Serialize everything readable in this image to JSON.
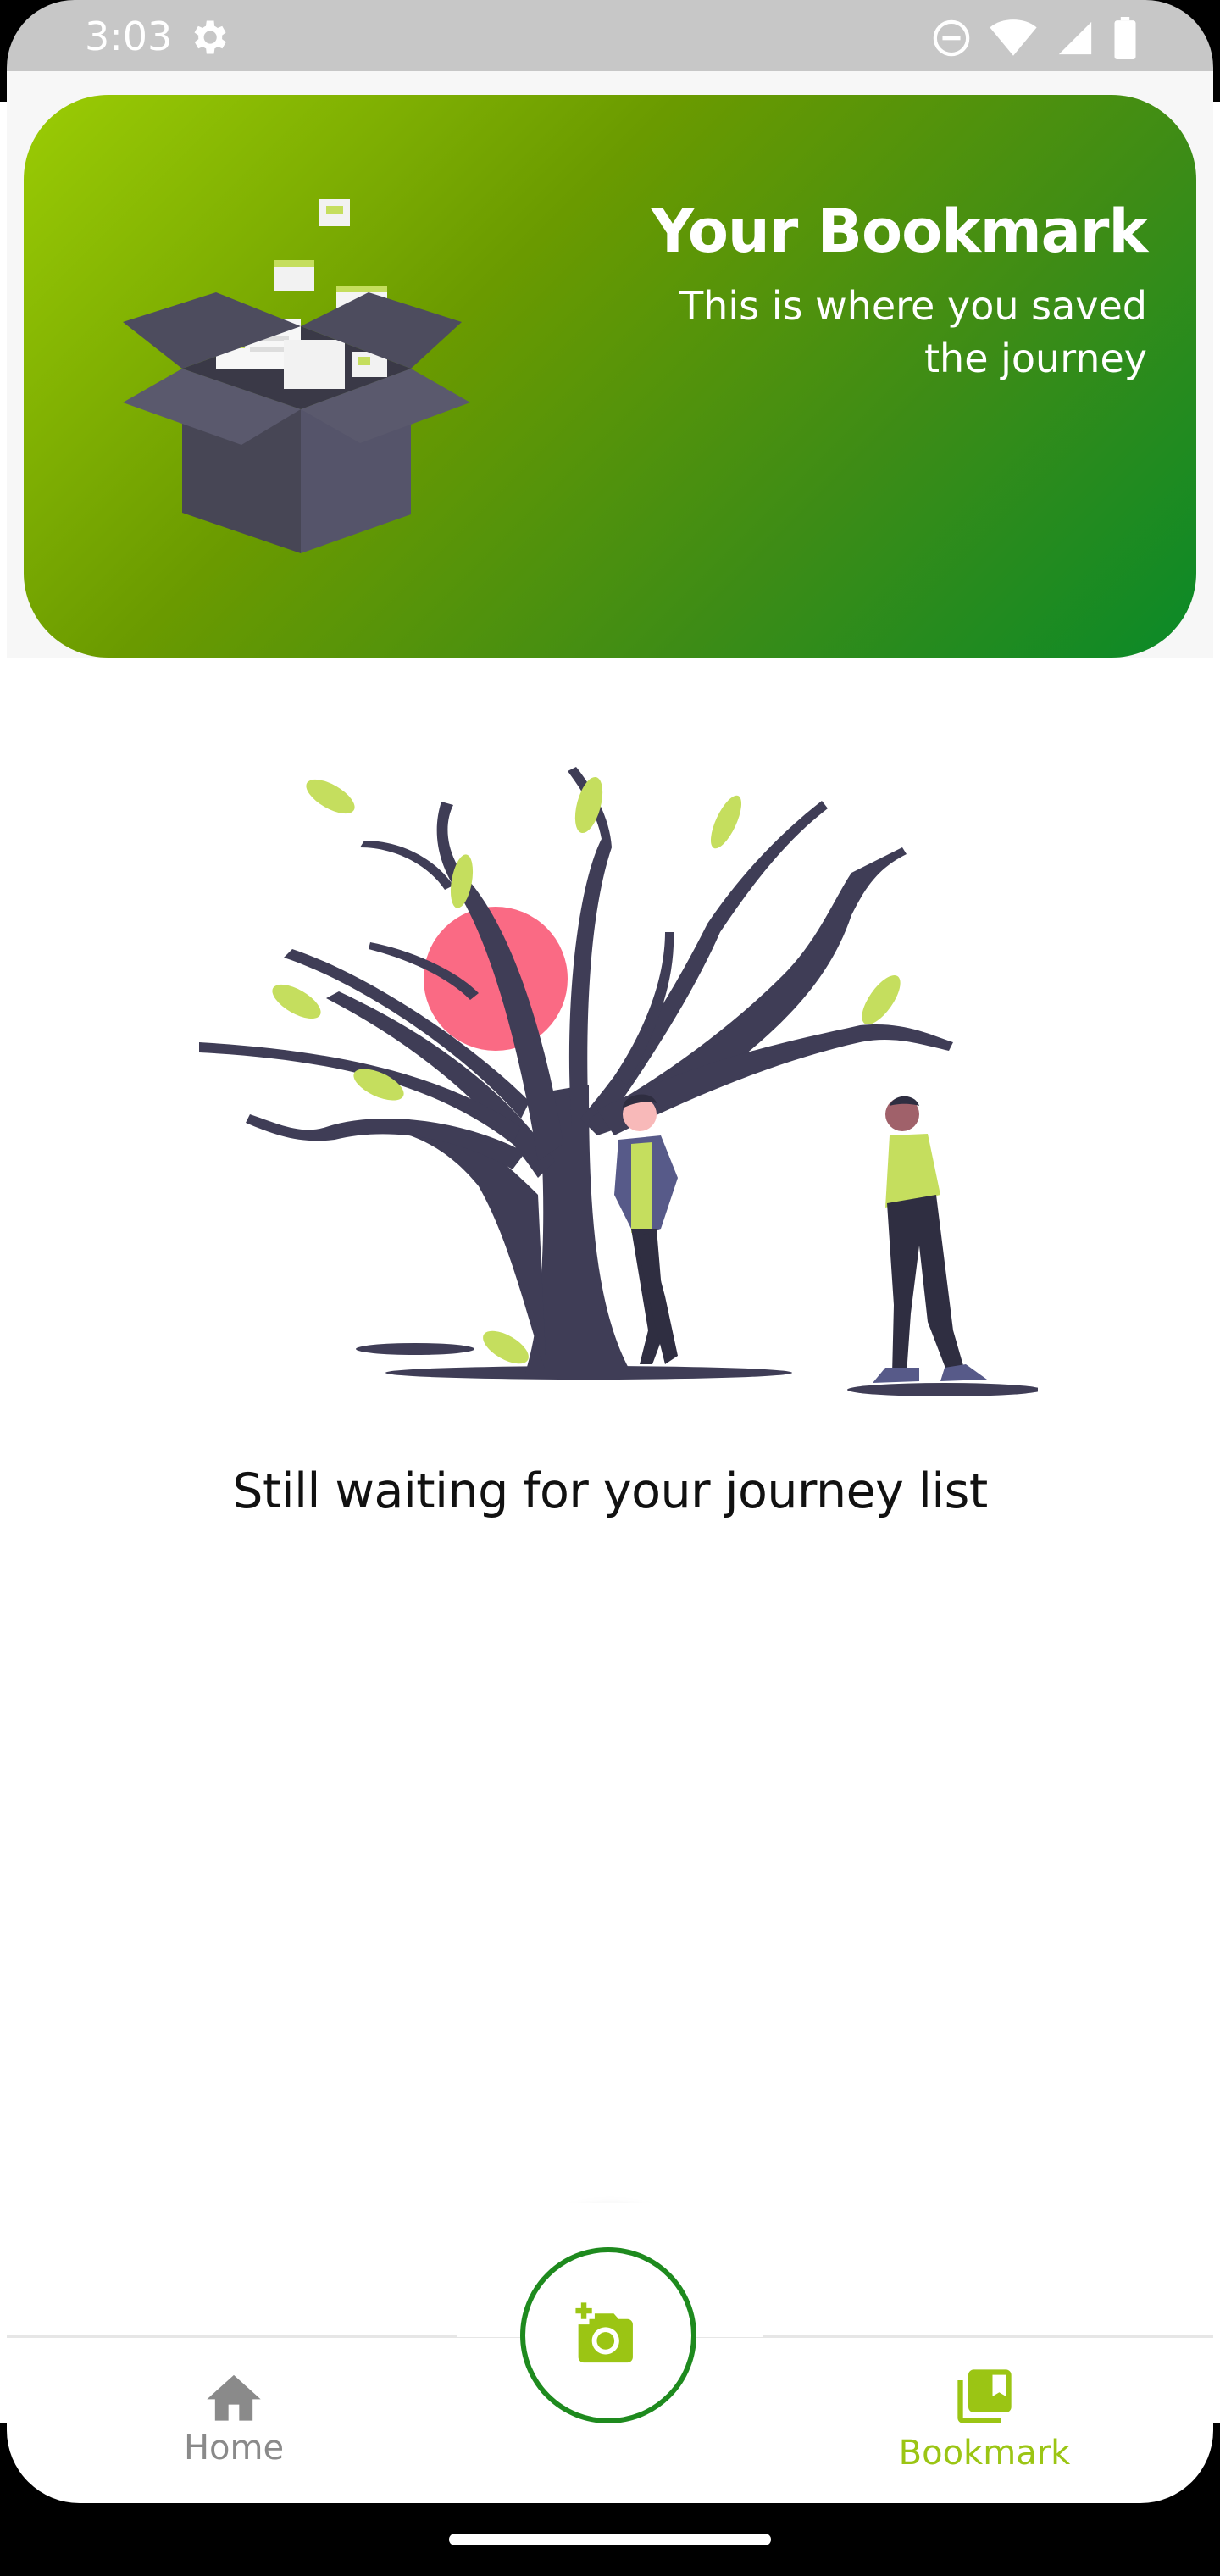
{
  "status_bar": {
    "time": "3:03",
    "icons": [
      "gear-icon",
      "do-not-disturb-icon",
      "wifi-icon",
      "cell-signal-icon",
      "battery-icon"
    ]
  },
  "header": {
    "title": "Your Bookmark",
    "subtitle": "This is where you saved the journey"
  },
  "empty_state": {
    "message": "Still waiting for your journey list"
  },
  "fab": {
    "icon": "add-photo-icon"
  },
  "bottom_nav": {
    "items": [
      {
        "label": "Home",
        "icon": "home-icon",
        "active": false
      },
      {
        "label": "Bookmark",
        "icon": "bookmark-icon",
        "active": true
      }
    ]
  },
  "colors": {
    "accent": "#9bc514",
    "fab_border": "#1e8a1e",
    "header_gradient_start": "#9bcc05",
    "header_gradient_end": "#0a8a28",
    "inactive": "#8a8a8a"
  }
}
